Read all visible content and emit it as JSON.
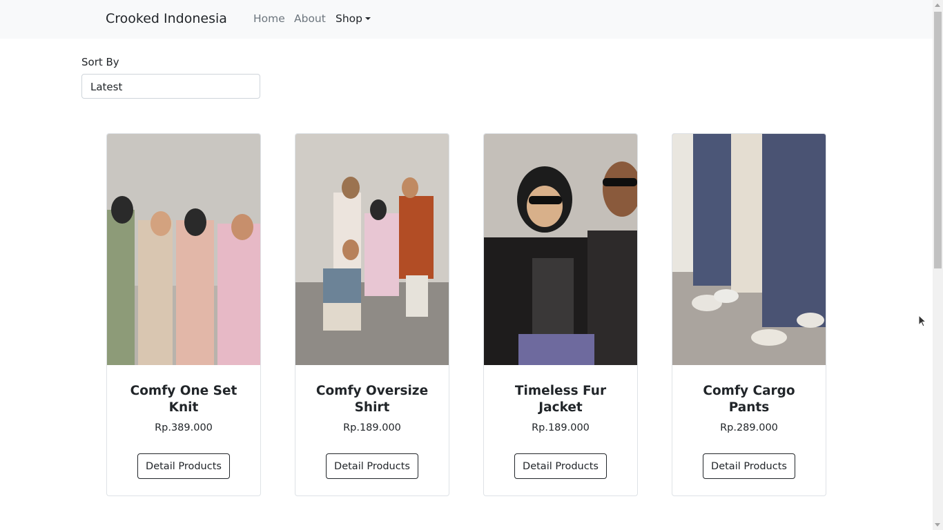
{
  "navbar": {
    "brand": "Crooked Indonesia",
    "links": [
      "Home",
      "About",
      "Shop"
    ],
    "active": "Shop"
  },
  "sort": {
    "label": "Sort By",
    "selected": "Latest"
  },
  "products": [
    {
      "name": "Comfy One Set Knit",
      "price": "Rp.389.000",
      "button": "Detail Products"
    },
    {
      "name": "Comfy Oversize Shirt",
      "price": "Rp.189.000",
      "button": "Detail Products"
    },
    {
      "name": "Timeless Fur Jacket",
      "price": "Rp.189.000",
      "button": "Detail Products"
    },
    {
      "name": "Comfy Cargo Pants",
      "price": "Rp.289.000",
      "button": "Detail Products"
    }
  ],
  "colors": {
    "navbar_bg": "#f8f9fa",
    "text": "#212529",
    "muted": "#6c757d",
    "border": "#dee2e6"
  }
}
